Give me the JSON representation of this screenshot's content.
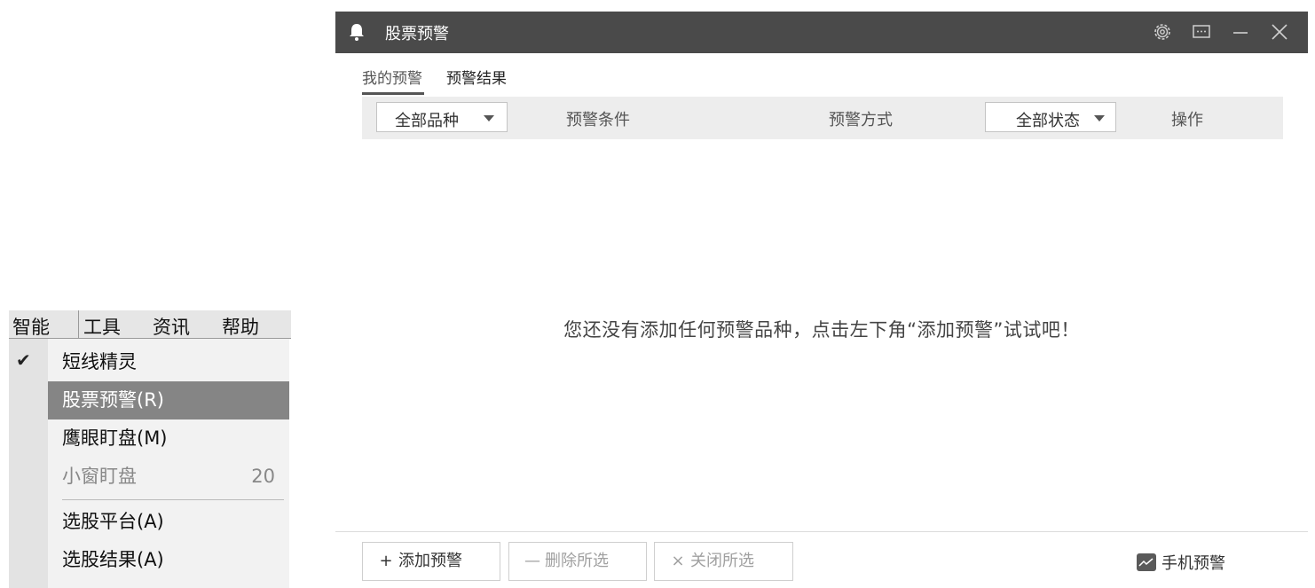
{
  "menubar": {
    "items": [
      "智能",
      "工具",
      "资讯",
      "帮助"
    ],
    "active_index": 0
  },
  "dropdown": {
    "items": [
      {
        "label": "短线精灵",
        "checked": true
      },
      {
        "label": "股票预警(R)",
        "selected": true
      },
      {
        "label": "鹰眼盯盘(M)"
      },
      {
        "label": "小窗盯盘",
        "hotkey": "20",
        "disabled": true
      },
      {
        "label": "选股平台(A)"
      },
      {
        "label": "选股结果(A)"
      }
    ]
  },
  "window": {
    "title": "股票预警",
    "icons": {
      "app": "bell-icon",
      "settings": "gear-icon",
      "chat": "message-icon",
      "minimize": "minimize-icon",
      "close": "close-icon"
    },
    "tabs": [
      "我的预警",
      "预警结果"
    ],
    "active_tab": 0,
    "table": {
      "filter_category": "全部品种",
      "col_condition": "预警条件",
      "col_method": "预警方式",
      "filter_status": "全部状态",
      "col_action": "操作"
    },
    "empty_message": "您还没有添加任何预警品种，点击左下角“添加预警”试试吧！",
    "footer": {
      "add": {
        "icon": "+",
        "label": "添加预警"
      },
      "delete": {
        "icon": "—",
        "label": "删除所选"
      },
      "close_selected": {
        "icon": "×",
        "label": "关闭所选"
      },
      "mobile": "手机预警"
    }
  }
}
